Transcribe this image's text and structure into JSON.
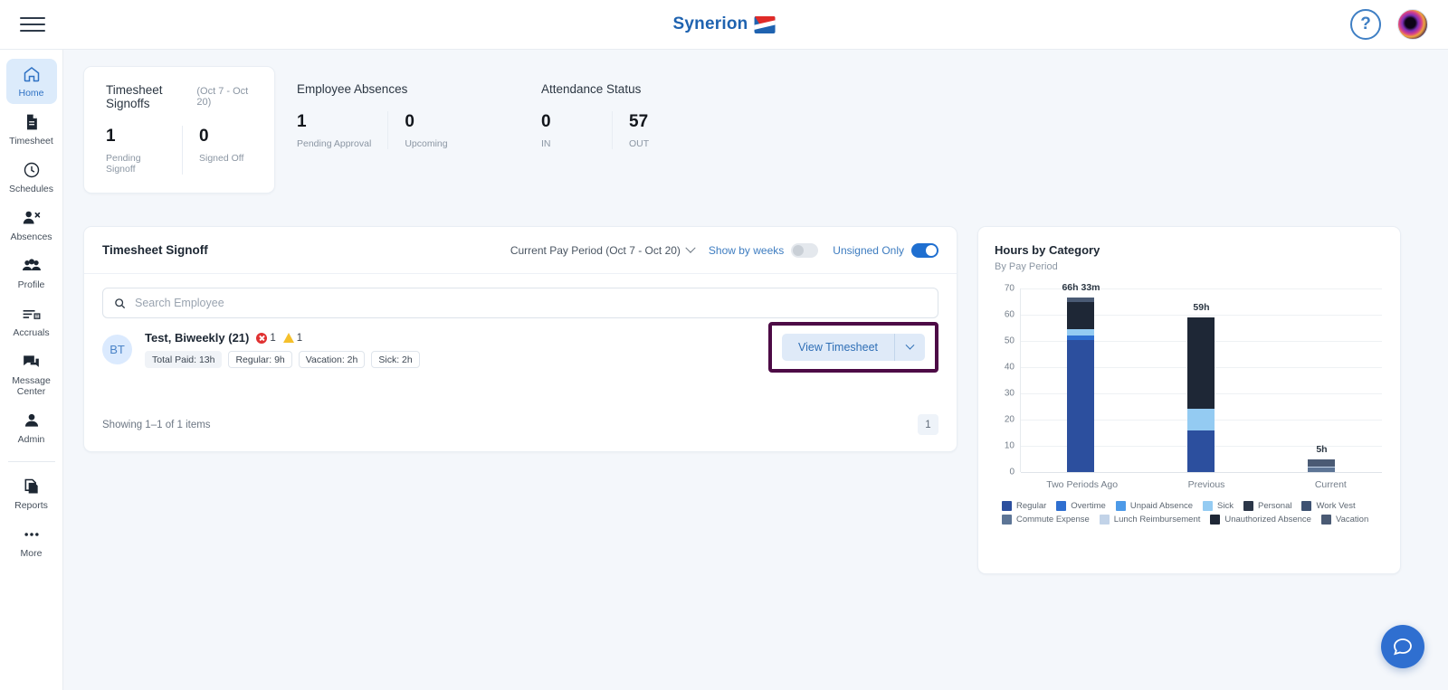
{
  "topbar": {
    "menu_icon": "hamburger-icon",
    "brand": "Synerion",
    "help_label": "?",
    "help_icon": "help-circle-icon",
    "avatar_icon": "user-avatar"
  },
  "sidebar": {
    "items": [
      {
        "label": "Home",
        "icon": "home-icon",
        "active": true
      },
      {
        "label": "Timesheet",
        "icon": "document-icon",
        "active": false
      },
      {
        "label": "Schedules",
        "icon": "clock-icon",
        "active": false
      },
      {
        "label": "Absences",
        "icon": "person-remove-icon",
        "active": false
      },
      {
        "label": "Profile",
        "icon": "people-icon",
        "active": false
      },
      {
        "label": "Accruals",
        "icon": "list-icon",
        "active": false
      },
      {
        "label": "Message Center",
        "icon": "chat-icon",
        "active": false
      },
      {
        "label": "Admin",
        "icon": "person-icon",
        "active": false
      }
    ],
    "bottom_items": [
      {
        "label": "Reports",
        "icon": "copy-icon"
      },
      {
        "label": "More",
        "icon": "ellipsis-icon"
      }
    ]
  },
  "kpis": [
    {
      "title": "Timesheet Signoffs",
      "subtitle": "(Oct 7 - Oct 20)",
      "stats": [
        {
          "value": "1",
          "label": "Pending Signoff"
        },
        {
          "value": "0",
          "label": "Signed Off"
        }
      ]
    },
    {
      "title": "Employee Absences",
      "subtitle": "",
      "stats": [
        {
          "value": "1",
          "label": "Pending Approval"
        },
        {
          "value": "0",
          "label": "Upcoming"
        }
      ]
    },
    {
      "title": "Attendance Status",
      "subtitle": "",
      "stats": [
        {
          "value": "0",
          "label": "IN"
        },
        {
          "value": "57",
          "label": "OUT"
        }
      ]
    }
  ],
  "signoff": {
    "title": "Timesheet Signoff",
    "pay_period": "Current Pay Period (Oct 7 - Oct 20)",
    "show_by_weeks_label": "Show by weeks",
    "show_by_weeks_on": false,
    "unsigned_only_label": "Unsigned Only",
    "unsigned_only_on": true,
    "search_placeholder": "Search Employee",
    "search_value": "",
    "search_icon": "search-icon",
    "employee": {
      "initials": "BT",
      "name": "Test, Biweekly (21)",
      "error_count": "1",
      "warning_count": "1",
      "chips": [
        {
          "text": "Total Paid: 13h",
          "filled": true
        },
        {
          "text": "Regular: 9h",
          "filled": false
        },
        {
          "text": "Vacation: 2h",
          "filled": false
        },
        {
          "text": "Sick: 2h",
          "filled": false
        }
      ]
    },
    "view_timesheet_label": "View Timesheet",
    "view_timesheet_caret": "chevron-down-icon",
    "highlight_color": "#4d0b46",
    "showing": "Showing 1–1 of 1 items",
    "page": "1"
  },
  "chart_data": {
    "type": "bar",
    "title": "Hours by Category",
    "subtitle": "By Pay Period",
    "stacked": true,
    "categories": [
      "Two Periods Ago",
      "Previous",
      "Current"
    ],
    "bar_labels": [
      "66h 33m",
      "59h",
      "5h"
    ],
    "totals": [
      66.55,
      59,
      5
    ],
    "ylim": [
      0,
      70
    ],
    "yticks": [
      0,
      10,
      20,
      30,
      40,
      50,
      60,
      70
    ],
    "ylabel": "",
    "xlabel": "",
    "grid": true,
    "legend_position": "bottom",
    "series": [
      {
        "name": "Regular",
        "color": "#2c4f9e",
        "values": [
          50.5,
          16,
          0
        ]
      },
      {
        "name": "Overtime",
        "color": "#2f6fd0",
        "values": [
          1.5,
          0,
          0
        ]
      },
      {
        "name": "Unpaid Absence",
        "color": "#4d9ae8",
        "values": [
          0,
          0,
          0
        ]
      },
      {
        "name": "Sick",
        "color": "#94cbf2",
        "values": [
          2.5,
          8,
          0
        ]
      },
      {
        "name": "Personal",
        "color": "#2b3648",
        "values": [
          0,
          0,
          0
        ]
      },
      {
        "name": "Work Vest",
        "color": "#3e5272",
        "values": [
          0,
          0,
          0
        ]
      },
      {
        "name": "Commute Expense",
        "color": "#5d7596",
        "values": [
          0,
          0,
          1.6
        ]
      },
      {
        "name": "Lunch Reimbursement",
        "color": "#c2d3e8",
        "values": [
          0,
          0,
          0.6
        ]
      },
      {
        "name": "Unauthorized Absence",
        "color": "#1e2736",
        "values": [
          10.5,
          35,
          0
        ]
      },
      {
        "name": "Vacation",
        "color": "#4a5a74",
        "values": [
          1.55,
          0,
          2.8
        ]
      }
    ]
  },
  "chat": {
    "icon": "chat-bubble-icon"
  }
}
